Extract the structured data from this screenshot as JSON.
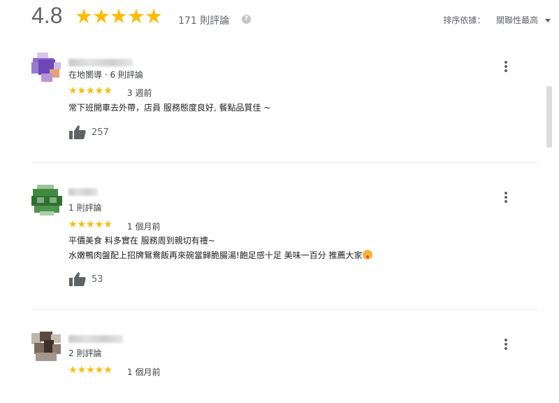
{
  "summary": {
    "rating": "4.8",
    "stars": "★★★★★",
    "review_count": "171 則評論",
    "help_icon": "question-icon"
  },
  "sort": {
    "label": "排序依據：",
    "value": "關聯性最高"
  },
  "reviews": [
    {
      "meta": "在地嚮導 · 6 則評論",
      "stars": "★★★★★",
      "time": "3 週前",
      "lines": [
        "常下班開車去外帶，店員 服務態度良好, 餐點品質佳 ~"
      ],
      "likes": "257"
    },
    {
      "meta": "1 則評論",
      "stars": "★★★★★",
      "time": "1 個月前",
      "lines": [
        "平價美食 料多實在 服務周到親切有禮~",
        "水嫩鴨肉盤配上招牌鴛鴦飯再來碗當歸脆腸湯!飽足感十足 美味一百分 推薦大家"
      ],
      "likes": "53"
    },
    {
      "meta": "2 則評論",
      "stars": "★★★★★",
      "time": "1 個月前"
    }
  ],
  "icons": {
    "like": "thumbs-up-icon",
    "more": "more-vertical-icon",
    "emoji": "face-savoring-food-emoji"
  },
  "colors": {
    "star": "#fbbc04",
    "text_secondary": "#5f6368"
  }
}
